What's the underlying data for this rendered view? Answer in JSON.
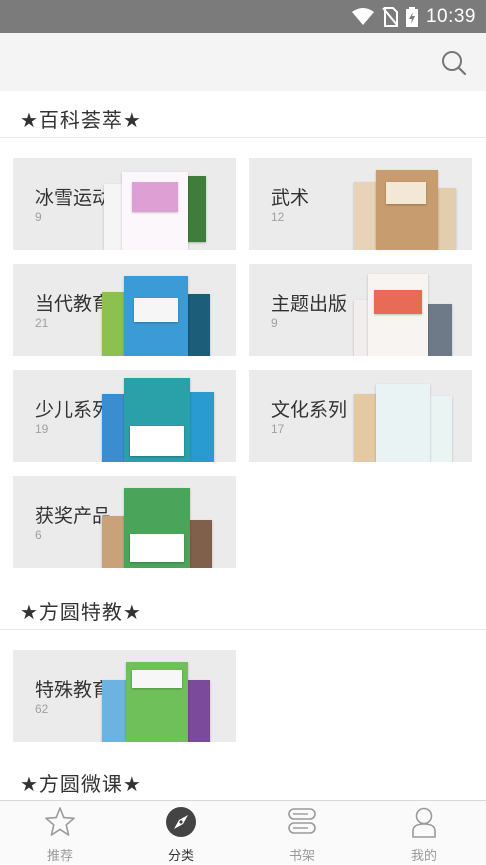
{
  "status_bar": {
    "time": "10:39"
  },
  "sections": [
    {
      "title": "★百科荟萃★"
    },
    {
      "title": "★方圆特教★"
    },
    {
      "title": "★方圆微课★"
    }
  ],
  "categories": [
    {
      "name": "冰雪运动",
      "count": "9"
    },
    {
      "name": "武术",
      "count": "12"
    },
    {
      "name": "当代教育",
      "count": "21"
    },
    {
      "name": "主题出版",
      "count": "9"
    },
    {
      "name": "少儿系列",
      "count": "19"
    },
    {
      "name": "文化系列",
      "count": "17"
    },
    {
      "name": "获奖产品",
      "count": "6"
    },
    {
      "name": "特殊教育",
      "count": "62"
    }
  ],
  "tabs": [
    {
      "label": "推荐",
      "icon": "star-icon"
    },
    {
      "label": "分类",
      "icon": "compass-icon"
    },
    {
      "label": "书架",
      "icon": "bookshelf-icon"
    },
    {
      "label": "我的",
      "icon": "user-icon"
    }
  ],
  "colors": {
    "status_bar": "#7b7b7b",
    "card_bg": "#ebebeb",
    "active_tab": "#333333",
    "inactive_tab": "#9a9a9a"
  }
}
